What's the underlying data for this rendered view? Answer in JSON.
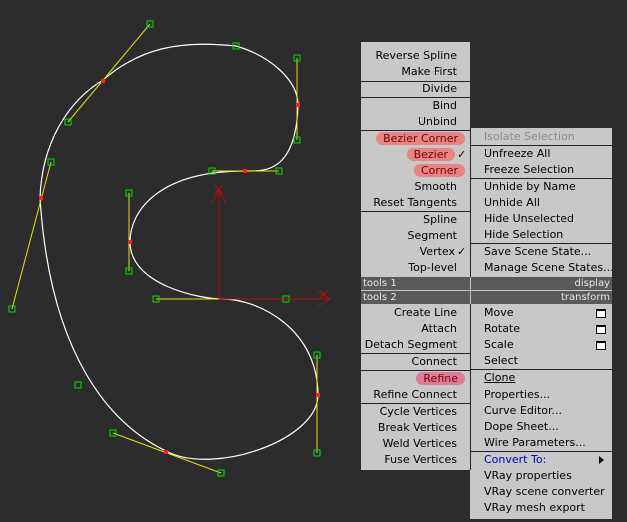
{
  "left_menu": {
    "items": [
      {
        "id": "reverse-spline",
        "label": "Reverse Spline"
      },
      {
        "id": "make-first",
        "label": "Make First"
      },
      {
        "id": "divide",
        "label": "Divide"
      },
      {
        "id": "bind",
        "label": "Bind"
      },
      {
        "id": "unbind",
        "label": "Unbind"
      },
      {
        "id": "bezier-corner",
        "label": "Bezier Corner"
      },
      {
        "id": "bezier",
        "label": "Bezier"
      },
      {
        "id": "corner",
        "label": "Corner"
      },
      {
        "id": "smooth",
        "label": "Smooth"
      },
      {
        "id": "reset-tangents",
        "label": "Reset Tangents"
      },
      {
        "id": "spline",
        "label": "Spline"
      },
      {
        "id": "segment",
        "label": "Segment"
      },
      {
        "id": "vertex",
        "label": "Vertex"
      },
      {
        "id": "top-level",
        "label": "Top-level"
      },
      {
        "id": "create-line",
        "label": "Create Line"
      },
      {
        "id": "attach",
        "label": "Attach"
      },
      {
        "id": "detach-segment",
        "label": "Detach Segment"
      },
      {
        "id": "connect",
        "label": "Connect"
      },
      {
        "id": "refine",
        "label": "Refine"
      },
      {
        "id": "refine-connect",
        "label": "Refine Connect"
      },
      {
        "id": "cycle-vertices",
        "label": "Cycle Vertices"
      },
      {
        "id": "break-vertices",
        "label": "Break Vertices"
      },
      {
        "id": "weld-vertices",
        "label": "Weld Vertices"
      },
      {
        "id": "fuse-vertices",
        "label": "Fuse Vertices"
      }
    ]
  },
  "right_menu": {
    "items": [
      {
        "id": "isolate-selection",
        "label": "Isolate Selection"
      },
      {
        "id": "unfreeze-all",
        "label": "Unfreeze All"
      },
      {
        "id": "freeze-selection",
        "label": "Freeze Selection"
      },
      {
        "id": "unhide-by-name",
        "label": "Unhide by Name"
      },
      {
        "id": "unhide-all",
        "label": "Unhide All"
      },
      {
        "id": "hide-unselected",
        "label": "Hide Unselected"
      },
      {
        "id": "hide-selection",
        "label": "Hide Selection"
      },
      {
        "id": "save-scene-state",
        "label": "Save Scene State..."
      },
      {
        "id": "manage-scene-states",
        "label": "Manage Scene States..."
      },
      {
        "id": "move",
        "label": "Move"
      },
      {
        "id": "rotate",
        "label": "Rotate"
      },
      {
        "id": "scale",
        "label": "Scale"
      },
      {
        "id": "select",
        "label": "Select"
      },
      {
        "id": "clone",
        "label": "Clone"
      },
      {
        "id": "properties",
        "label": "Properties..."
      },
      {
        "id": "curve-editor",
        "label": "Curve Editor..."
      },
      {
        "id": "dope-sheet",
        "label": "Dope Sheet..."
      },
      {
        "id": "wire-parameters",
        "label": "Wire Parameters..."
      },
      {
        "id": "convert-to",
        "label": "Convert To:"
      },
      {
        "id": "vray-properties",
        "label": "VRay properties"
      },
      {
        "id": "vray-scene-converter",
        "label": "VRay scene converter"
      },
      {
        "id": "vray-mesh-export",
        "label": "VRay mesh export"
      }
    ]
  },
  "headers": {
    "tools1": "tools 1",
    "display": "display",
    "tools2": "tools 2",
    "transform": "transform"
  },
  "marks": {
    "checkmark": "✓"
  },
  "colors": {
    "viewport_bg": "#2c2c2c",
    "spline": "#ffffff",
    "tangent": "#e8e000",
    "vertex_handle": "#00e000",
    "gizmo": "#b01010",
    "menu_bg": "#c8c8c8",
    "header_bg": "#5a5a5a",
    "pill": "#e88484"
  }
}
